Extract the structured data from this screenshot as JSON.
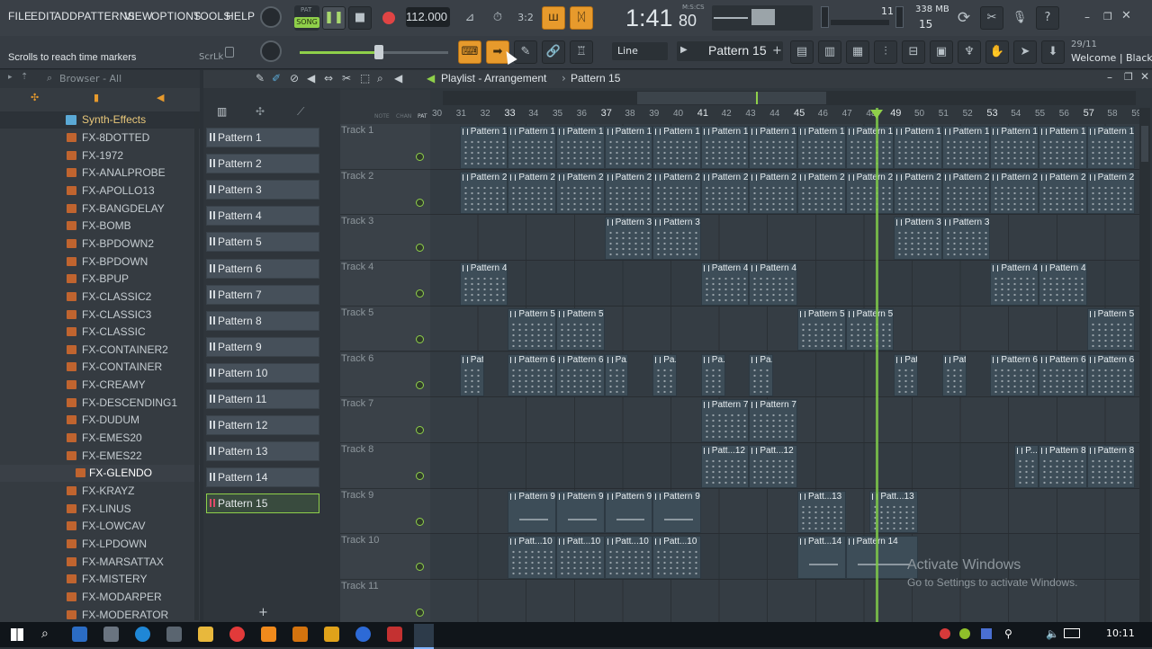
{
  "menu": [
    "FILE",
    "EDIT",
    "ADD",
    "PATTERNS",
    "VIEW",
    "OPTIONS",
    "TOOLS",
    "HELP"
  ],
  "transport": {
    "mode_top": "PAT",
    "mode_bottom": "SONG",
    "tempo": "112.000",
    "time": "1:41",
    "time_sub": "80",
    "time_unit": "M:S:CS",
    "cpu_value": "11",
    "memory": "338 MB",
    "voices": "15"
  },
  "hint": {
    "text": "Scrolls to reach time markers",
    "scroll_lock": "ScrLk"
  },
  "snap": "Line",
  "pattern_selector": "Pattern 15",
  "news": {
    "date": "29/11",
    "text": "Welcome | Black"
  },
  "browser": {
    "title": "Browser - All",
    "folder": "Synth-Effects",
    "items": [
      "FX-8DOTTED",
      "FX-1972",
      "FX-ANALPROBE",
      "FX-APOLLO13",
      "FX-BANGDELAY",
      "FX-BOMB",
      "FX-BPDOWN2",
      "FX-BPDOWN",
      "FX-BPUP",
      "FX-CLASSIC2",
      "FX-CLASSIC3",
      "FX-CLASSIC",
      "FX-CONTAINER2",
      "FX-CONTAINER",
      "FX-CREAMY",
      "FX-DESCENDING1",
      "FX-DUDUM",
      "FX-EMES20",
      "FX-EMES22",
      "FX-GLENDO",
      "FX-KRAYZ",
      "FX-LINUS",
      "FX-LOWCAV",
      "FX-LPDOWN",
      "FX-MARSATTAX",
      "FX-MISTERY",
      "FX-MODARPER",
      "FX-MODERATOR"
    ]
  },
  "pattern_picker": [
    "Pattern 1",
    "Pattern 2",
    "Pattern 3",
    "Pattern 4",
    "Pattern 5",
    "Pattern 6",
    "Pattern 7",
    "Pattern 8",
    "Pattern 9",
    "Pattern 10",
    "Pattern 11",
    "Pattern 12",
    "Pattern 13",
    "Pattern 14",
    "Pattern 15"
  ],
  "playlist": {
    "title": "Playlist - Arrangement",
    "current_pattern": "Pattern 15",
    "header_labels": {
      "notes": "NOTE",
      "chan": "CHAN",
      "pat": "PAT"
    },
    "tracks": [
      "Track 1",
      "Track 2",
      "Track 3",
      "Track 4",
      "Track 5",
      "Track 6",
      "Track 7",
      "Track 8",
      "Track 9",
      "Track 10",
      "Track 11"
    ],
    "bars": [
      "30",
      "31",
      "32",
      "33",
      "34",
      "35",
      "36",
      "37",
      "38",
      "39",
      "40",
      "41",
      "42",
      "43",
      "44",
      "45",
      "46",
      "47",
      "48",
      "49",
      "50",
      "51",
      "52",
      "53",
      "54",
      "55",
      "56",
      "57",
      "58",
      "59"
    ],
    "clips": [
      {
        "track": 0,
        "bars": [
          [
            31,
            1
          ],
          [
            33,
            1
          ],
          [
            35,
            1
          ],
          [
            37,
            1
          ],
          [
            39,
            1
          ],
          [
            41,
            1
          ],
          [
            43,
            1
          ],
          [
            45,
            1
          ],
          [
            47,
            1
          ],
          [
            49,
            1
          ],
          [
            51,
            1
          ],
          [
            53,
            1
          ],
          [
            55,
            1
          ],
          [
            57,
            1
          ]
        ],
        "label": "Pattern 1",
        "style": "dots"
      },
      {
        "track": 1,
        "bars": [
          [
            31,
            1
          ],
          [
            33,
            1
          ],
          [
            35,
            1
          ],
          [
            37,
            1
          ],
          [
            39,
            1
          ],
          [
            41,
            1
          ],
          [
            43,
            1
          ],
          [
            45,
            1
          ],
          [
            47,
            1
          ],
          [
            49,
            1
          ],
          [
            51,
            1
          ],
          [
            53,
            1
          ],
          [
            55,
            1
          ],
          [
            57,
            1
          ]
        ],
        "label": "Pattern 2",
        "style": "dots"
      },
      {
        "track": 2,
        "bars": [
          [
            37,
            1
          ],
          [
            39,
            1
          ],
          [
            49,
            1
          ],
          [
            51,
            1
          ]
        ],
        "label": "Pattern 3",
        "style": "dots"
      },
      {
        "track": 3,
        "bars": [
          [
            31,
            1
          ],
          [
            41,
            1
          ],
          [
            43,
            1
          ],
          [
            53,
            1
          ],
          [
            55,
            1
          ]
        ],
        "label": "Pattern 4",
        "style": "dots"
      },
      {
        "track": 4,
        "bars": [
          [
            33,
            1
          ],
          [
            35,
            1
          ],
          [
            45,
            1
          ],
          [
            47,
            1
          ],
          [
            57,
            1
          ]
        ],
        "label": "Pattern 5",
        "style": "dots"
      },
      {
        "track": 5,
        "bars": [
          [
            31,
            0.5
          ],
          [
            33,
            1
          ],
          [
            35,
            1
          ],
          [
            49,
            0.5
          ],
          [
            51,
            0.5
          ],
          [
            53,
            1
          ],
          [
            55,
            1
          ],
          [
            57,
            1
          ]
        ],
        "label": "Pattern 6",
        "style": "dots"
      },
      {
        "track": 5,
        "bars": [
          [
            37,
            0.5
          ],
          [
            39,
            0.5
          ],
          [
            41,
            0.5
          ],
          [
            43,
            0.5
          ]
        ],
        "label": "Pa...6",
        "style": "dots"
      },
      {
        "track": 6,
        "bars": [
          [
            41,
            1
          ],
          [
            43,
            1
          ]
        ],
        "label": "Pattern 7",
        "style": "dots"
      },
      {
        "track": 7,
        "bars": [
          [
            41,
            1
          ],
          [
            43,
            1
          ]
        ],
        "label": "Patt...12",
        "style": "dots"
      },
      {
        "track": 7,
        "bars": [
          [
            54,
            0.5
          ]
        ],
        "label": "P...8",
        "style": "dots"
      },
      {
        "track": 7,
        "bars": [
          [
            55,
            1
          ],
          [
            57,
            1
          ]
        ],
        "label": "Pattern 8",
        "style": "dots"
      },
      {
        "track": 8,
        "bars": [
          [
            33,
            1
          ],
          [
            35,
            1
          ],
          [
            37,
            1
          ],
          [
            39,
            1
          ]
        ],
        "label": "Pattern 9",
        "style": "line"
      },
      {
        "track": 8,
        "bars": [
          [
            45,
            1
          ],
          [
            48,
            1
          ]
        ],
        "label": "Patt...13",
        "style": "dots"
      },
      {
        "track": 9,
        "bars": [
          [
            33,
            1
          ],
          [
            35,
            1
          ],
          [
            37,
            1
          ],
          [
            39,
            1
          ]
        ],
        "label": "Patt...10",
        "style": "dots"
      },
      {
        "track": 9,
        "bars": [
          [
            45,
            1
          ]
        ],
        "label": "Patt...14",
        "style": "line"
      },
      {
        "track": 9,
        "bars": [
          [
            47,
            1.5
          ]
        ],
        "label": "Pattern 14",
        "style": "line"
      }
    ]
  },
  "watermark": {
    "title": "Activate Windows",
    "subtitle": "Go to Settings to activate Windows."
  },
  "taskbar": {
    "clock": "10:11"
  },
  "colors": {
    "accent_green": "#8fd04a",
    "accent_orange": "#e79a2c",
    "playhead": "#7ec84a"
  }
}
